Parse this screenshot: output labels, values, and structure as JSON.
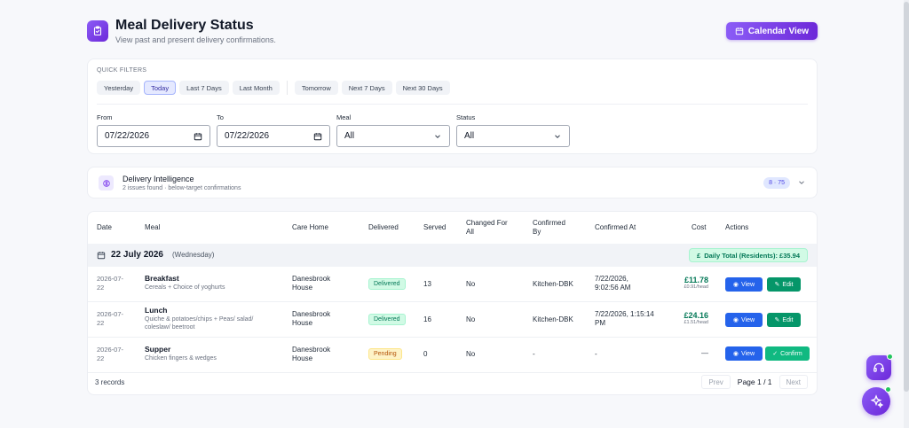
{
  "header": {
    "title": "Meal Delivery Status",
    "subtitle": "View past and present delivery confirmations.",
    "calendar_button": "Calendar View"
  },
  "filters": {
    "quick_label": "QUICK FILTERS",
    "quick": [
      "Yesterday",
      "Today",
      "Last 7 Days",
      "Last Month"
    ],
    "future": [
      "Tomorrow",
      "Next 7 Days",
      "Next 30 Days"
    ],
    "active": "Today",
    "from_label": "From",
    "from_value": "07/22/2026",
    "to_label": "To",
    "to_value": "07/22/2026",
    "meal_label": "Meal",
    "meal_value": "All",
    "status_label": "Status",
    "status_value": "All"
  },
  "intel": {
    "title": "Delivery Intelligence",
    "subtitle": "2 issues found · below-target confirmations",
    "badge": "8 · 75"
  },
  "table": {
    "headers": {
      "date": "Date",
      "meal": "Meal",
      "care_home": "Care Home",
      "delivered": "Delivered",
      "served": "Served",
      "changed_1": "Changed For",
      "changed_2": "All",
      "confirmed_by_1": "Confirmed",
      "confirmed_by_2": "By",
      "confirmed_at": "Confirmed At",
      "cost": "Cost",
      "actions": "Actions"
    },
    "group": {
      "date": "22 July 2026",
      "weekday": "(Wednesday)",
      "daily_total": "Daily Total (Residents): £35.94"
    },
    "rows": [
      {
        "date_1": "2026-07-",
        "date_2": "22",
        "meal": "Breakfast",
        "desc": "Cereals + Choice of yoghurts",
        "home_1": "Danesbrook",
        "home_2": "House",
        "status": "Delivered",
        "served": "13",
        "changed": "No",
        "confirmed_by": "Kitchen-DBK",
        "confirmed_at_1": "7/22/2026,",
        "confirmed_at_2": "9:02:56 AM",
        "cost": "£11.78",
        "cost_unit": "£0.91/head",
        "btn1": "View",
        "btn2": "Edit"
      },
      {
        "date_1": "2026-07-",
        "date_2": "22",
        "meal": "Lunch",
        "desc_1": "Quiche & potatoes/chips + Peas/ salad/",
        "desc_2": "coleslaw/ beetroot",
        "home_1": "Danesbrook",
        "home_2": "House",
        "status": "Delivered",
        "served": "16",
        "changed": "No",
        "confirmed_by": "Kitchen-DBK",
        "confirmed_at_1": "7/22/2026, 1:15:14",
        "confirmed_at_2": "PM",
        "cost": "£24.16",
        "cost_unit": "£1.51/head",
        "btn1": "View",
        "btn2": "Edit"
      },
      {
        "date_1": "2026-07-",
        "date_2": "22",
        "meal": "Supper",
        "desc": "Chicken fingers & wedges",
        "home_1": "Danesbrook",
        "home_2": "House",
        "status": "Pending",
        "served": "0",
        "changed": "No",
        "confirmed_by": "-",
        "confirmed_at": "-",
        "cost": "—",
        "btn1": "View",
        "btn2": "Confirm"
      }
    ],
    "records": "3 records",
    "prev": "Prev",
    "page_info": "Page 1 / 1",
    "next": "Next"
  },
  "icons": {
    "header": "clipboard-check-icon",
    "calendar": "calendar-icon",
    "intel": "brain-icon",
    "support": "headset-icon",
    "assistant": "sparkles-icon"
  },
  "colors": {
    "accent": "#7c3aed",
    "view": "#2563eb",
    "edit": "#059669",
    "delivered": "#047857",
    "pending": "#b45309"
  }
}
